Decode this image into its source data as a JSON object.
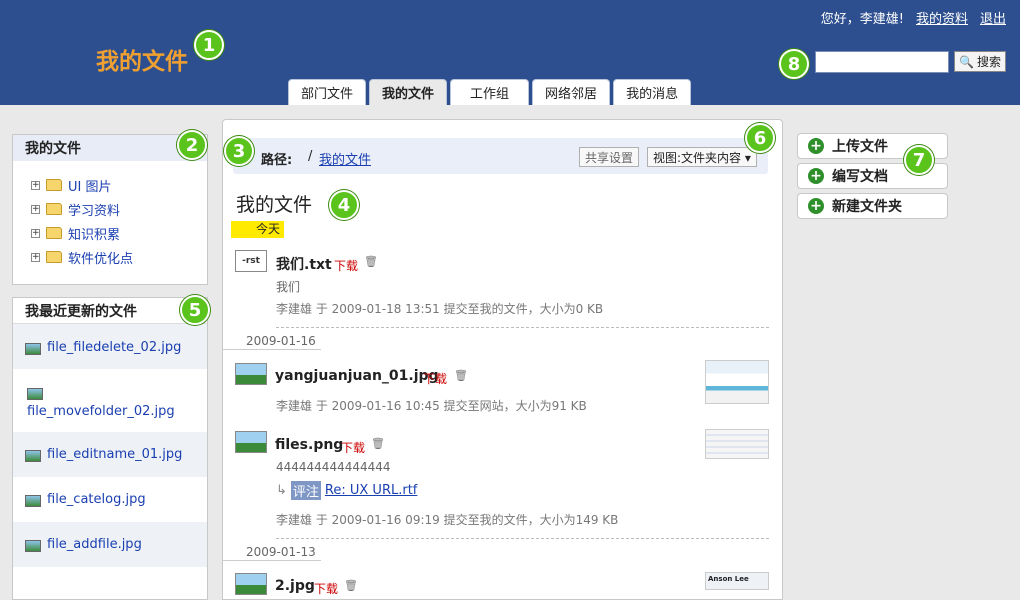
{
  "header": {
    "greeting": "您好，",
    "username": "李建雄!",
    "profile_link": "我的资料",
    "logout_link": "退出",
    "logo": "我的文件",
    "search_placeholder": "",
    "search_button": "搜索",
    "brand_color": "#2d4f8f",
    "logo_color": "#f0a030"
  },
  "tabs": [
    {
      "label": "部门文件"
    },
    {
      "label": "我的文件",
      "active": true
    },
    {
      "label": "工作组"
    },
    {
      "label": "网络邻居"
    },
    {
      "label": "我的消息"
    }
  ],
  "badges": [
    "1",
    "2",
    "3",
    "4",
    "5",
    "6",
    "7",
    "8"
  ],
  "sidebar": {
    "tree_title": "我的文件",
    "tree_items": [
      "UI 图片",
      "学习资料",
      "知识积累",
      "软件优化点"
    ],
    "recent_title": "我最近更新的文件",
    "recent_items": [
      "file_filedelete_02.jpg",
      "file_movefolder_02.jpg",
      "file_editname_01.jpg",
      "file_catelog.jpg",
      "file_addfile.jpg"
    ]
  },
  "main": {
    "path_label": "路径:",
    "path_sep": "/",
    "path_link": "我的文件",
    "share_button": "共享设置",
    "view_button": "视图:文件夹内容 ▾",
    "title": "我的文件",
    "today_tag": "今天",
    "download": "下载",
    "files": [
      {
        "name": "我们.txt",
        "desc": "我们",
        "meta": "李建雄 于 2009-01-18 13:51 提交至我的文件，大小为0 KB",
        "icon_text": "-rst"
      },
      {
        "name": "yangjuanjuan_01.jpg",
        "meta": "李建雄 于 2009-01-16 10:45 提交至网站，大小为91 KB"
      },
      {
        "name": "files.png",
        "desc": "444444444444444",
        "comment_tag": "评注",
        "comment_link": "Re: UX URL.rtf",
        "meta": "李建雄 于 2009-01-16 09:19 提交至我的文件，大小为149 KB"
      },
      {
        "name": "2.jpg",
        "preview_text": "Anson Lee"
      }
    ],
    "date_headers": [
      "2009-01-16",
      "2009-01-13"
    ]
  },
  "actions": [
    "上传文件",
    "编写文档",
    "新建文件夹"
  ]
}
